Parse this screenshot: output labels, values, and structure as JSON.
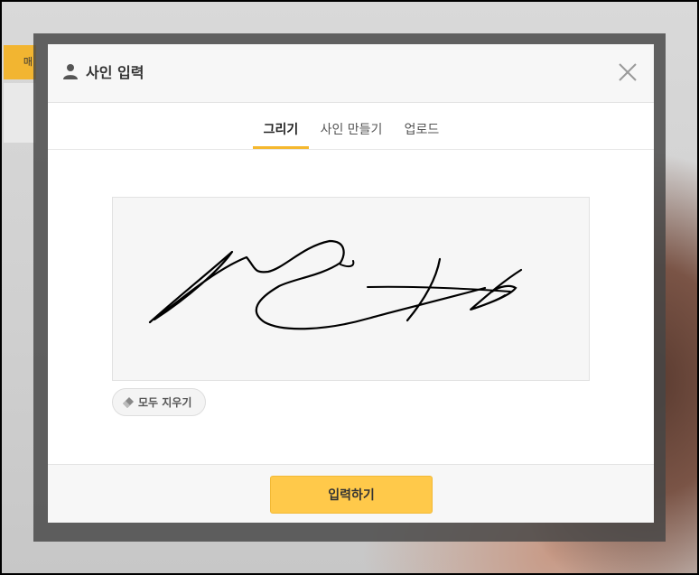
{
  "background": {
    "tag_label": "매"
  },
  "modal": {
    "title": "사인 입력",
    "title_icon": "user-icon",
    "close_icon": "close-icon"
  },
  "tabs": [
    {
      "label": "그리기",
      "active": true
    },
    {
      "label": "사인 만들기",
      "active": false
    },
    {
      "label": "업로드",
      "active": false
    }
  ],
  "signature_pad": {
    "has_signature": true
  },
  "clear_button": {
    "icon": "eraser-icon",
    "label": "모두 지우기"
  },
  "footer": {
    "submit_label": "입력하기"
  },
  "colors": {
    "accent": "#f5b82e",
    "submit_bg": "#ffc94a",
    "header_bg": "#f7f7f7",
    "pad_bg": "#f6f6f6"
  }
}
